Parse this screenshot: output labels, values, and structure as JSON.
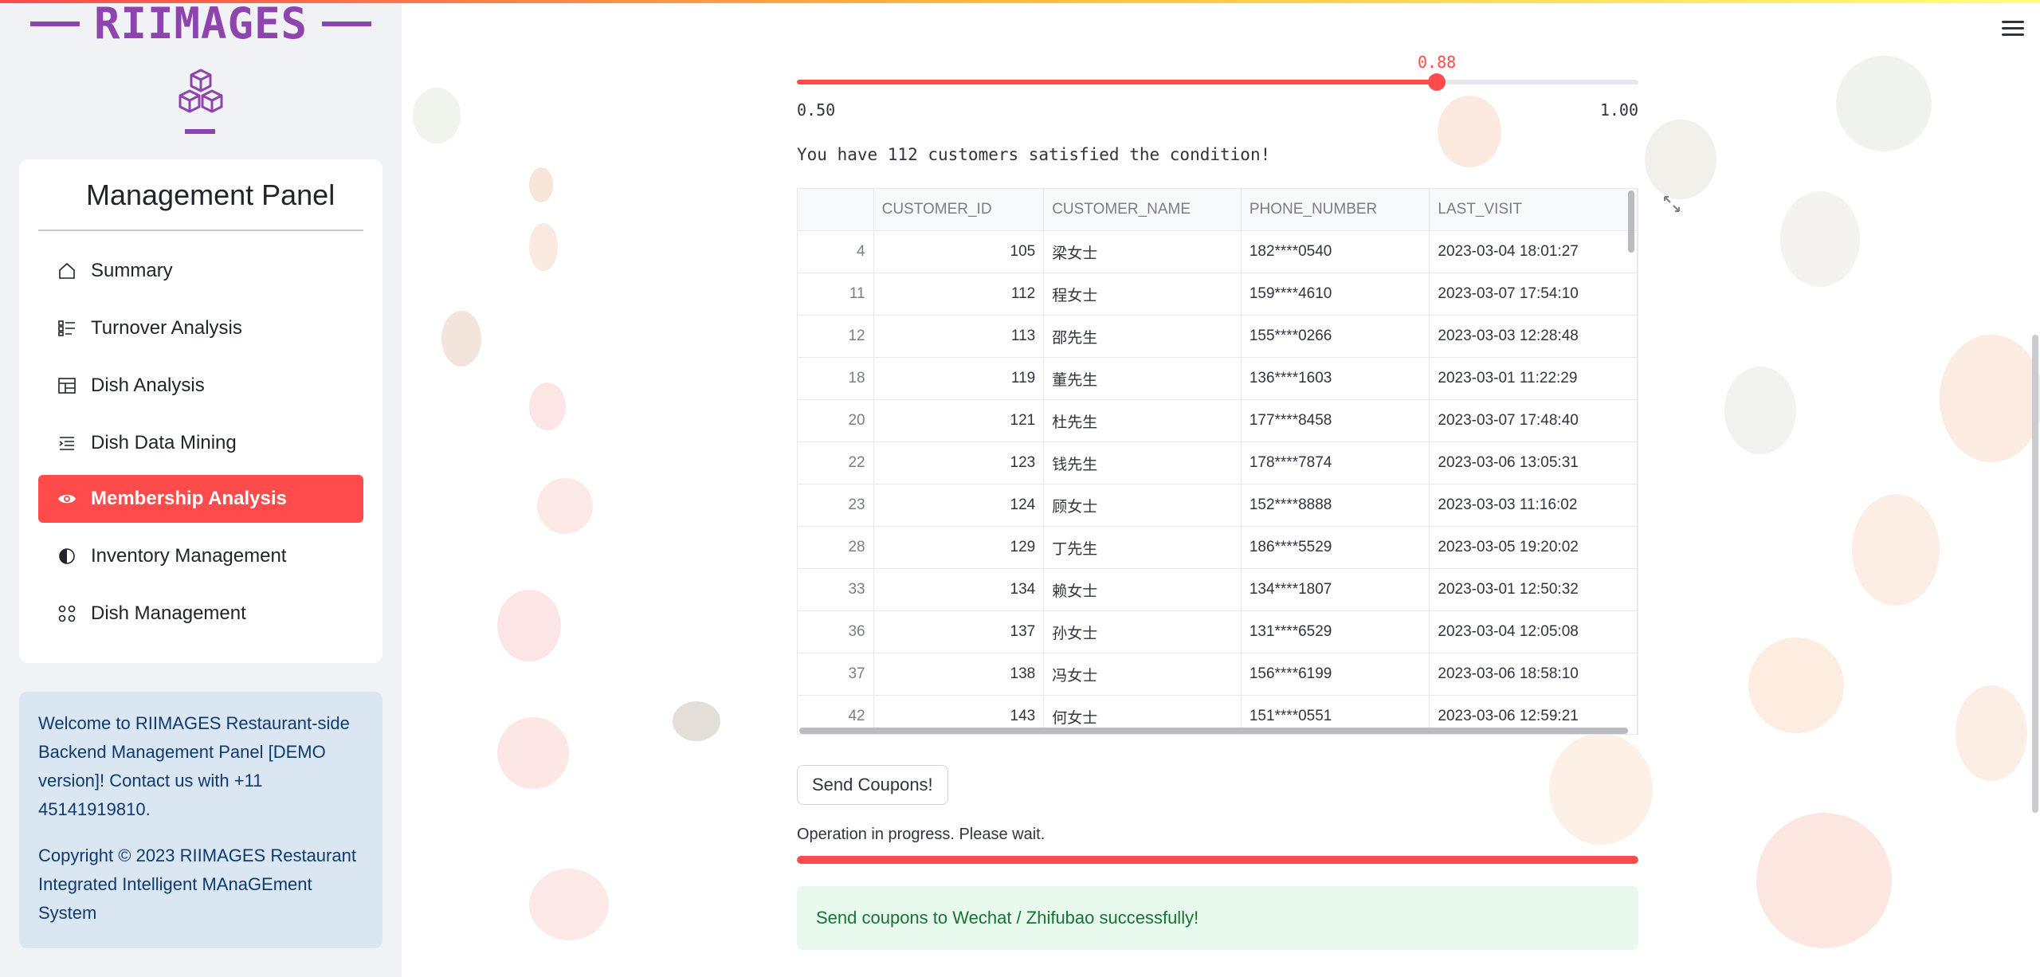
{
  "brand": {
    "name": "RIIMAGES",
    "accent": "#8e44ad"
  },
  "menu": {
    "title": "Management Panel",
    "items": [
      {
        "label": "Summary",
        "icon": "house-icon",
        "active": false
      },
      {
        "label": "Turnover Analysis",
        "icon": "list-check-icon",
        "active": false
      },
      {
        "label": "Dish Analysis",
        "icon": "layout-grid-icon",
        "active": false
      },
      {
        "label": "Dish Data Mining",
        "icon": "text-indent-icon",
        "active": false
      },
      {
        "label": "Membership Analysis",
        "icon": "eye-icon",
        "active": true
      },
      {
        "label": "Inventory Management",
        "icon": "circle-half-icon",
        "active": false
      },
      {
        "label": "Dish Management",
        "icon": "apps-icon",
        "active": false
      }
    ],
    "active_color": "#ff4b4b"
  },
  "info": {
    "welcome": "Welcome to RIIMAGES Restaurant-side Backend Management Panel [DEMO version]! Contact us with +11 45141919810.",
    "copyright": "Copyright © 2023 RIIMAGES Restaurant Integrated Intelligent MAnaGEment System"
  },
  "slider": {
    "value": 0.88,
    "value_label": "0.88",
    "min": 0.5,
    "min_label": "0.50",
    "max": 1.0,
    "max_label": "1.00"
  },
  "result": {
    "count_text": "You have 112 customers satisfied the condition!"
  },
  "table": {
    "columns": [
      "",
      "CUSTOMER_ID",
      "CUSTOMER_NAME",
      "PHONE_NUMBER",
      "LAST_VISIT"
    ],
    "rows": [
      [
        "4",
        "105",
        "梁女士",
        "182****0540",
        "2023-03-04 18:01:27"
      ],
      [
        "11",
        "112",
        "程女士",
        "159****4610",
        "2023-03-07 17:54:10"
      ],
      [
        "12",
        "113",
        "邵先生",
        "155****0266",
        "2023-03-03 12:28:48"
      ],
      [
        "18",
        "119",
        "董先生",
        "136****1603",
        "2023-03-01 11:22:29"
      ],
      [
        "20",
        "121",
        "杜先生",
        "177****8458",
        "2023-03-07 17:48:40"
      ],
      [
        "22",
        "123",
        "钱先生",
        "178****7874",
        "2023-03-06 13:05:31"
      ],
      [
        "23",
        "124",
        "顾女士",
        "152****8888",
        "2023-03-03 11:16:02"
      ],
      [
        "28",
        "129",
        "丁先生",
        "186****5529",
        "2023-03-05 19:20:02"
      ],
      [
        "33",
        "134",
        "赖女士",
        "134****1807",
        "2023-03-01 12:50:32"
      ],
      [
        "36",
        "137",
        "孙女士",
        "131****6529",
        "2023-03-04 12:05:08"
      ],
      [
        "37",
        "138",
        "冯女士",
        "156****6199",
        "2023-03-06 18:58:10"
      ],
      [
        "42",
        "143",
        "何女士",
        "151****0551",
        "2023-03-06 12:59:21"
      ]
    ]
  },
  "actions": {
    "send_label": "Send Coupons!"
  },
  "progress": {
    "label": "Operation in progress. Please wait.",
    "value": 1.0
  },
  "success": {
    "message": "Send coupons to Wechat / Zhifubao successfully!"
  }
}
